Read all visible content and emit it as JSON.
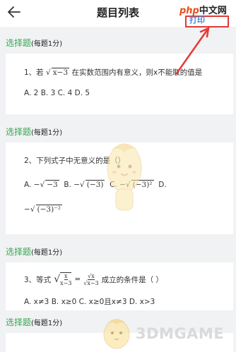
{
  "header": {
    "title": "题目列表",
    "watermark_php": "php",
    "watermark_cn": "中文网",
    "highlight_label": "打印"
  },
  "sections": [
    {
      "type": "选择题",
      "note": "(每题1分)",
      "question": {
        "prefix": "1、若",
        "radicand": "x−3",
        "suffix": "在实数范围内有意义，则x不能取的值是",
        "options": "A. 2 B. 3 C. 4 D. 5"
      }
    },
    {
      "type": "选择题",
      "note": "(每题1分)",
      "question": {
        "text": "2、下列式子中无意义的是（）",
        "opt_a": "A. −",
        "opt_a_rad": "−3",
        "opt_b": "B. −",
        "opt_b_rad": "(−3)",
        "opt_c": "C. −",
        "opt_c_rad": "(−3)²",
        "opt_d": "D.",
        "opt_d2": "−",
        "opt_d2_rad": "(−3)⁻²"
      }
    },
    {
      "type": "选择题",
      "note": "(每题1分)",
      "question": {
        "prefix": "3、等式",
        "suffix": "成立的条件是（ ）",
        "frac_num": "x",
        "frac_den": "x−3",
        "rhs_num": "√x",
        "rhs_den": "√x−3",
        "options": "A. x≠3 B. x≥0 C. x≥0且x≠3 D. x>3"
      }
    },
    {
      "type": "选择题",
      "note": "(每题1分)"
    }
  ],
  "watermark_bottom": "3DMGAME",
  "colors": {
    "accent_green": "#36a852",
    "highlight_red": "#e53935",
    "background": "#f1f2f4"
  }
}
